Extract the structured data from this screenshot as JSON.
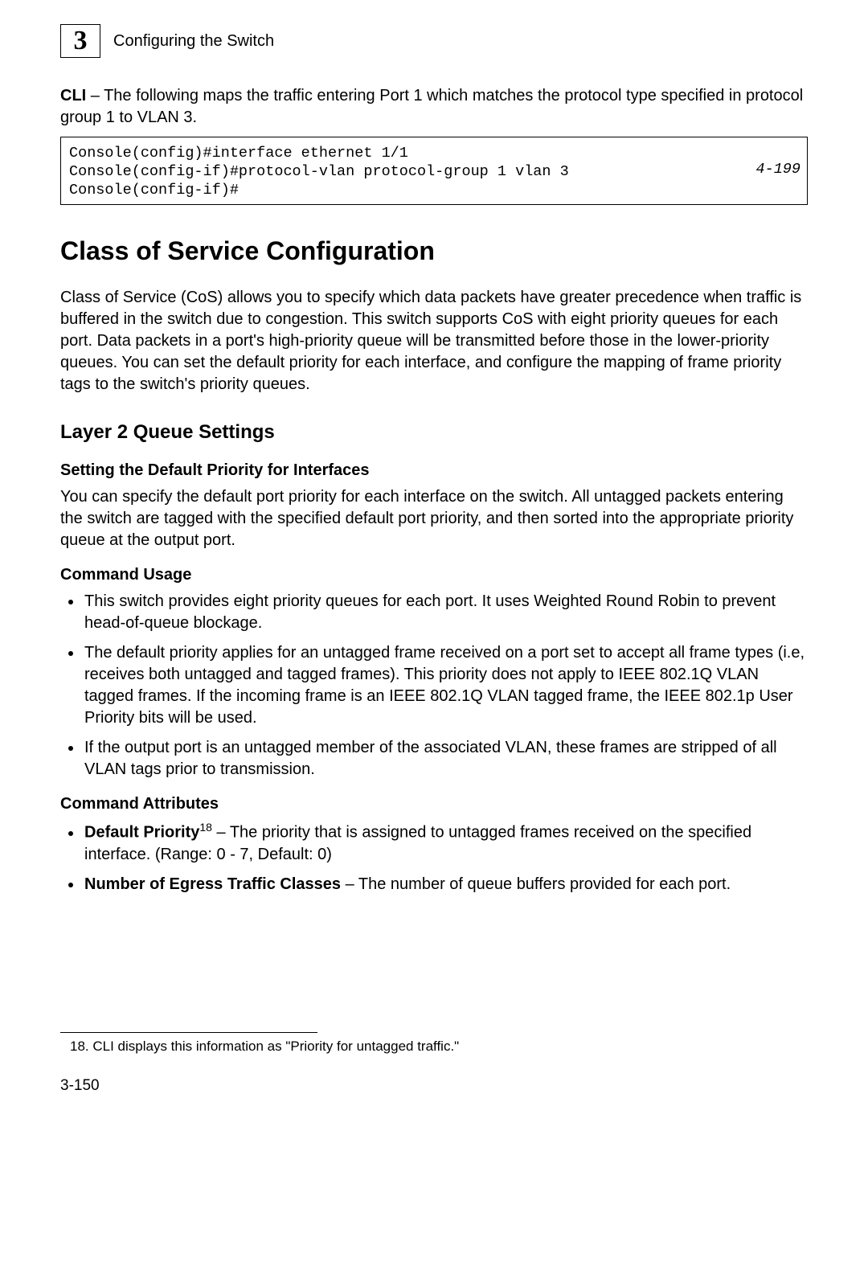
{
  "header": {
    "chapter_number": "3",
    "title": "Configuring the Switch"
  },
  "intro_cli": {
    "label": "CLI",
    "text": " – The following maps the traffic entering Port 1 which matches the protocol type specified in protocol group 1 to VLAN 3."
  },
  "code_box": {
    "line1": "Console(config)#interface ethernet 1/1",
    "line2": "Console(config-if)#protocol-vlan protocol-group 1 vlan 3",
    "line3": "Console(config-if)#",
    "ref": "4-199"
  },
  "section": {
    "title": "Class of Service Configuration",
    "body": "Class of Service (CoS) allows you to specify which data packets have greater precedence when traffic is buffered in the switch due to congestion. This switch supports CoS with eight priority queues for each port. Data packets in a port's high-priority queue will be transmitted before those in the lower-priority queues. You can set the default priority for each interface, and configure the mapping of frame priority tags to the switch's priority queues."
  },
  "subsection": {
    "title": "Layer 2 Queue Settings"
  },
  "subsub": {
    "title": "Setting the Default Priority for Interfaces",
    "body": "You can specify the default port priority for each interface on the switch. All untagged packets entering the switch are tagged with the specified default port priority, and then sorted into the appropriate priority queue at the output port."
  },
  "command_usage": {
    "title": "Command Usage",
    "items": [
      "This switch provides eight priority queues for each port. It uses Weighted Round Robin to prevent head-of-queue blockage.",
      "The default priority applies for an untagged frame received on a port set to accept all frame types (i.e, receives both untagged and tagged frames). This priority does not apply to IEEE 802.1Q VLAN tagged frames. If the incoming frame is an IEEE 802.1Q VLAN tagged frame, the IEEE 802.1p User Priority bits will be used.",
      "If the output port is an untagged member of the associated VLAN, these frames are stripped of all VLAN tags prior to transmission."
    ]
  },
  "command_attributes": {
    "title": "Command Attributes",
    "items": [
      {
        "label": "Default Priority",
        "sup": "18",
        "text": " – The priority that is assigned to untagged frames received on the specified interface. (Range: 0 - 7, Default: 0)"
      },
      {
        "label": "Number of Egress Traffic Classes",
        "sup": "",
        "text": " – The number of queue buffers provided for each port."
      }
    ]
  },
  "footnote": {
    "num": "18.",
    "text": " CLI displays this information as \"Priority for untagged traffic.\""
  },
  "page_number": "3-150"
}
